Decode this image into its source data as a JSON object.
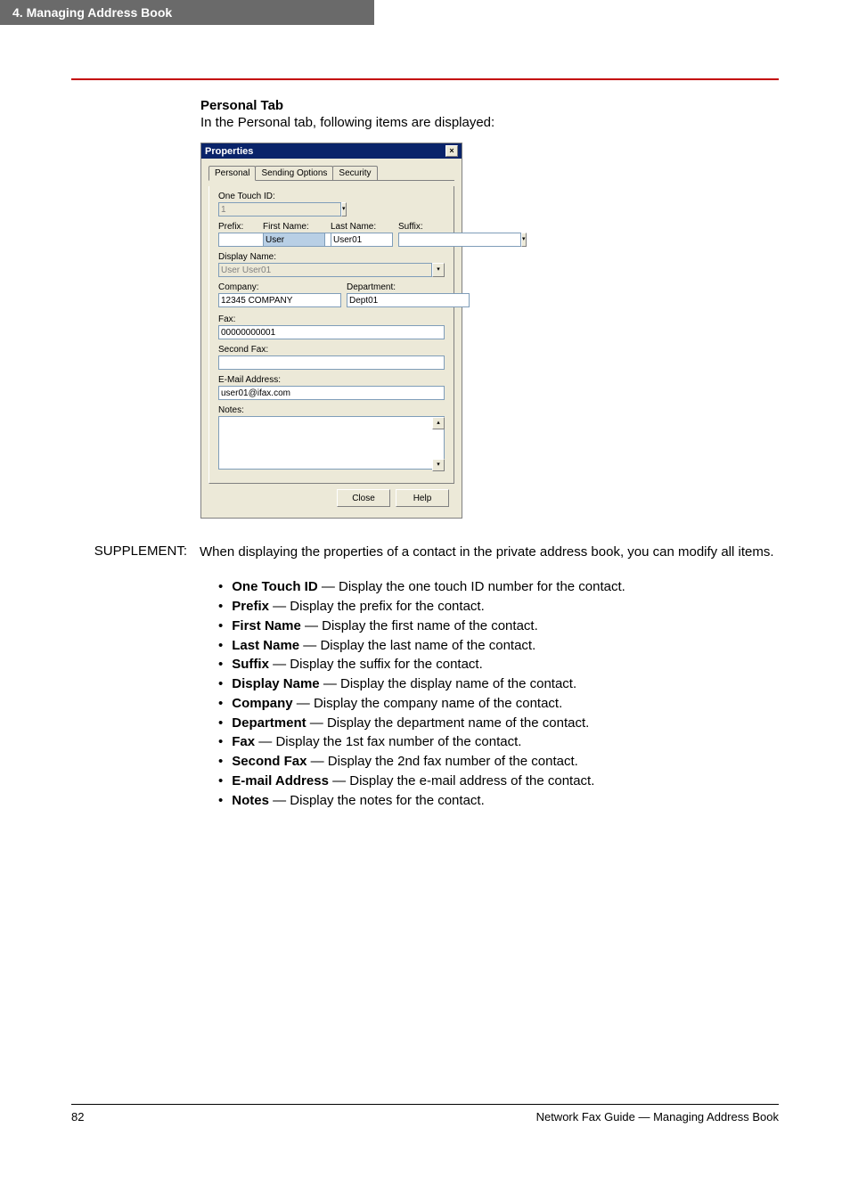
{
  "header": {
    "chapter": "4.  Managing Address Book"
  },
  "section": {
    "title": "Personal Tab",
    "desc": "In the Personal tab, following items are displayed:"
  },
  "dialog": {
    "title": "Properties",
    "close_glyph": "×",
    "tabs": {
      "personal": "Personal",
      "sending": "Sending Options",
      "security": "Security"
    },
    "labels": {
      "one_touch": "One Touch ID:",
      "prefix": "Prefix:",
      "first_name": "First Name:",
      "last_name": "Last Name:",
      "suffix": "Suffix:",
      "display_name": "Display Name:",
      "company": "Company:",
      "department": "Department:",
      "fax": "Fax:",
      "second_fax": "Second Fax:",
      "email": "E-Mail Address:",
      "notes": "Notes:"
    },
    "values": {
      "one_touch": "1",
      "prefix": "",
      "first_name": "User",
      "last_name": "User01",
      "suffix": "",
      "display_name": "User User01",
      "company": "12345 COMPANY",
      "department": "Dept01",
      "fax": "00000000001",
      "second_fax": "",
      "email": "user01@ifax.com",
      "notes": ""
    },
    "buttons": {
      "close": "Close",
      "help": "Help"
    },
    "dropdown_glyph": "▾",
    "scroll_up": "▴",
    "scroll_down": "▾"
  },
  "supplement": {
    "label": "SUPPLEMENT:",
    "text": "When displaying the properties of a contact in the private address book, you can modify all items."
  },
  "bullets": [
    {
      "term": "One Touch ID",
      "desc": " — Display the one touch ID number for the contact."
    },
    {
      "term": "Prefix",
      "desc": " — Display the prefix for the contact."
    },
    {
      "term": "First Name",
      "desc": " — Display the first name of the contact."
    },
    {
      "term": "Last Name",
      "desc": " — Display the last name of the contact."
    },
    {
      "term": "Suffix",
      "desc": " — Display the suffix for the contact."
    },
    {
      "term": "Display Name",
      "desc": " — Display the display name of the contact."
    },
    {
      "term": "Company",
      "desc": " — Display the company name of the contact."
    },
    {
      "term": "Department",
      "desc": " — Display the department name of the contact."
    },
    {
      "term": "Fax",
      "desc": " — Display the 1st fax number of the contact."
    },
    {
      "term": "Second Fax",
      "desc": " — Display the 2nd fax number of the contact."
    },
    {
      "term": "E-mail Address",
      "desc": " — Display the e-mail address of the contact."
    },
    {
      "term": "Notes",
      "desc": " — Display the notes for the contact."
    }
  ],
  "footer": {
    "page": "82",
    "right": "Network Fax Guide — Managing Address Book"
  }
}
